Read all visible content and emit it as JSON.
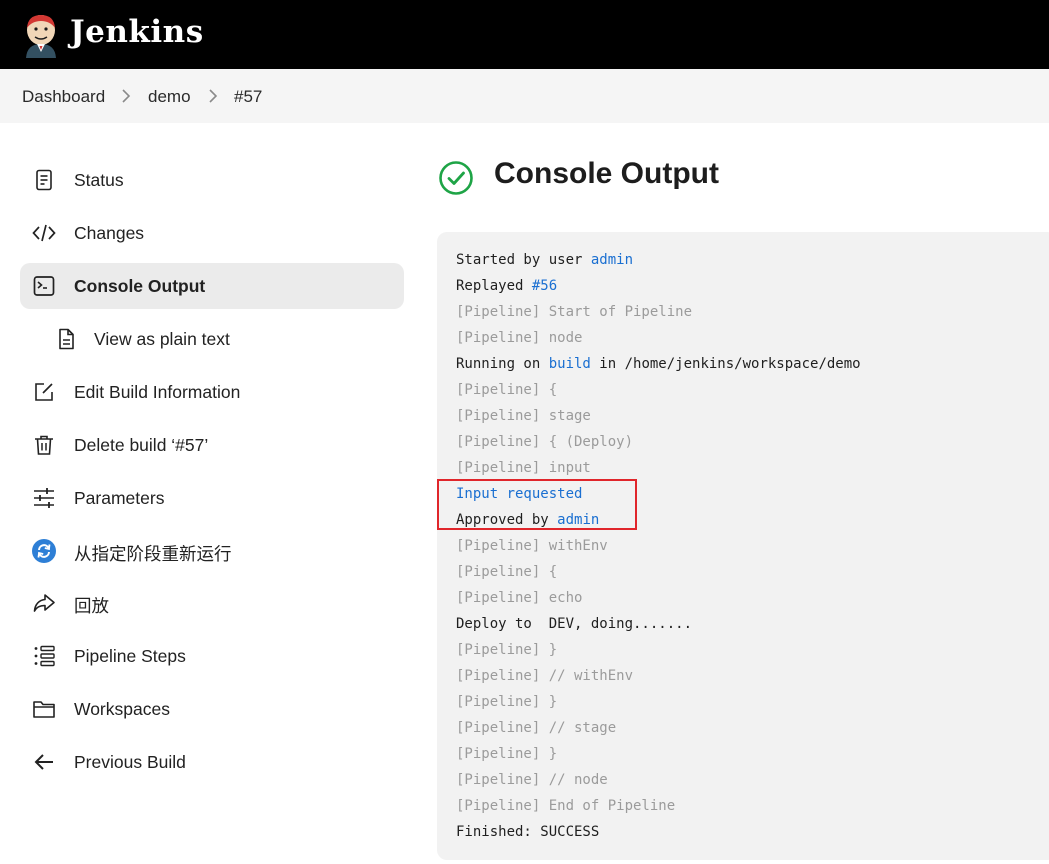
{
  "header": {
    "brand": "Jenkins",
    "logo_icon": "jenkins-butler-logo",
    "bg_color": "#000000"
  },
  "breadcrumb": {
    "items": [
      "Dashboard",
      "demo",
      "#57"
    ]
  },
  "sidebar": {
    "items": [
      {
        "label": "Status",
        "icon": "document-icon"
      },
      {
        "label": "Changes",
        "icon": "code-icon"
      },
      {
        "label": "Console Output",
        "icon": "terminal-icon",
        "active": true
      },
      {
        "label": "View as plain text",
        "icon": "file-text-icon",
        "sub": true
      },
      {
        "label": "Edit Build Information",
        "icon": "edit-icon"
      },
      {
        "label": "Delete build ‘#57’",
        "icon": "trash-icon"
      },
      {
        "label": "Parameters",
        "icon": "sliders-icon"
      },
      {
        "label": "从指定阶段重新运行",
        "icon": "restart-icon"
      },
      {
        "label": "回放",
        "icon": "replay-icon"
      },
      {
        "label": "Pipeline Steps",
        "icon": "list-icon"
      },
      {
        "label": "Workspaces",
        "icon": "folder-icon"
      },
      {
        "label": "Previous Build",
        "icon": "arrow-left-icon"
      }
    ]
  },
  "main": {
    "title": "Console Output",
    "title_icon": "success-check-icon",
    "success_color": "#1ea446",
    "link_color": "#1a6fd1",
    "highlight_color": "#e0262b"
  },
  "console": {
    "lines": [
      {
        "parts": [
          {
            "t": "Started by user "
          },
          {
            "t": "admin",
            "link": true
          }
        ]
      },
      {
        "parts": [
          {
            "t": "Replayed "
          },
          {
            "t": "#56",
            "link": true
          }
        ]
      },
      {
        "parts": [
          {
            "t": "[Pipeline] Start of Pipeline"
          }
        ],
        "style": "pipe"
      },
      {
        "parts": [
          {
            "t": "[Pipeline] node"
          }
        ],
        "style": "pipe"
      },
      {
        "parts": [
          {
            "t": "Running on "
          },
          {
            "t": "build",
            "link": true
          },
          {
            "t": " in /home/jenkins/workspace/demo"
          }
        ]
      },
      {
        "parts": [
          {
            "t": "[Pipeline] {"
          }
        ],
        "style": "pipe"
      },
      {
        "parts": [
          {
            "t": "[Pipeline] stage"
          }
        ],
        "style": "pipe"
      },
      {
        "parts": [
          {
            "t": "[Pipeline] { (Deploy)"
          }
        ],
        "style": "pipe"
      },
      {
        "parts": [
          {
            "t": "[Pipeline] input"
          }
        ],
        "style": "pipe"
      },
      {
        "parts": [
          {
            "t": "Input requested"
          }
        ],
        "style": "blue"
      },
      {
        "parts": [
          {
            "t": "Approved by "
          },
          {
            "t": "admin",
            "link": true
          }
        ]
      },
      {
        "parts": [
          {
            "t": "[Pipeline] withEnv"
          }
        ],
        "style": "pipe"
      },
      {
        "parts": [
          {
            "t": "[Pipeline] {"
          }
        ],
        "style": "pipe"
      },
      {
        "parts": [
          {
            "t": "[Pipeline] echo"
          }
        ],
        "style": "pipe"
      },
      {
        "parts": [
          {
            "t": "Deploy to  DEV, doing......."
          }
        ]
      },
      {
        "parts": [
          {
            "t": "[Pipeline] }"
          }
        ],
        "style": "pipe"
      },
      {
        "parts": [
          {
            "t": "[Pipeline] // withEnv"
          }
        ],
        "style": "pipe"
      },
      {
        "parts": [
          {
            "t": "[Pipeline] }"
          }
        ],
        "style": "pipe"
      },
      {
        "parts": [
          {
            "t": "[Pipeline] // stage"
          }
        ],
        "style": "pipe"
      },
      {
        "parts": [
          {
            "t": "[Pipeline] }"
          }
        ],
        "style": "pipe"
      },
      {
        "parts": [
          {
            "t": "[Pipeline] // node"
          }
        ],
        "style": "pipe"
      },
      {
        "parts": [
          {
            "t": "[Pipeline] End of Pipeline"
          }
        ],
        "style": "pipe"
      },
      {
        "parts": [
          {
            "t": "Finished: SUCCESS"
          }
        ]
      }
    ]
  }
}
